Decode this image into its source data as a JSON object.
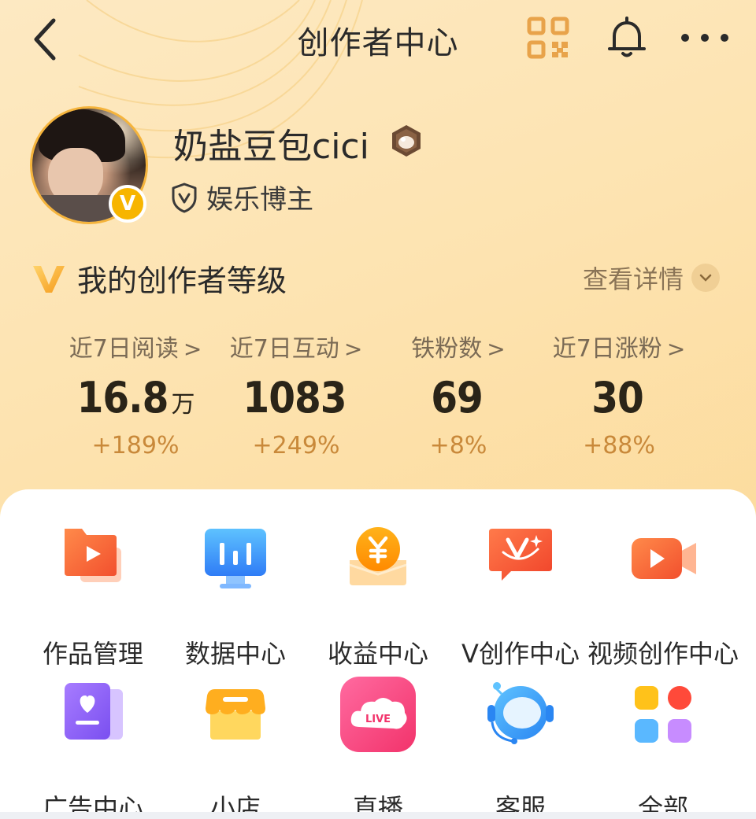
{
  "header": {
    "title": "创作者中心",
    "icons": [
      "back-chevron-icon",
      "qr-code-icon",
      "bell-icon",
      "more-dots-icon"
    ],
    "qr_color": "#e8a34a"
  },
  "profile": {
    "username": "奶盐豆包cici",
    "verified_badge": "V",
    "role": "娱乐博主"
  },
  "level": {
    "title": "我的创作者等级",
    "detail_link": "查看详情"
  },
  "stats": [
    {
      "label": "近7日阅读",
      "value": "16.8",
      "unit": "万",
      "change": "+189%"
    },
    {
      "label": "近7日互动",
      "value": "1083",
      "unit": "",
      "change": "+249%"
    },
    {
      "label": "铁粉数",
      "value": "69",
      "unit": "",
      "change": "+8%"
    },
    {
      "label": "近7日涨粉",
      "value": "30",
      "unit": "",
      "change": "+88%"
    }
  ],
  "stat_chevron": ">",
  "tools": [
    {
      "label": "作品管理",
      "icon": "works-folder-play-icon"
    },
    {
      "label": "数据中心",
      "icon": "data-chart-icon"
    },
    {
      "label": "收益中心",
      "icon": "yuan-coin-icon"
    },
    {
      "label": "V创作中心",
      "icon": "v-creation-icon"
    },
    {
      "label": "视频创作中心",
      "icon": "video-camera-icon"
    },
    {
      "label": "广告中心",
      "icon": "ad-heart-book-icon"
    },
    {
      "label": "小店",
      "icon": "shop-awning-icon"
    },
    {
      "label": "直播",
      "icon": "live-icon"
    },
    {
      "label": "客服",
      "icon": "customer-service-astronaut-icon"
    },
    {
      "label": "全部",
      "icon": "all-apps-grid-icon"
    }
  ],
  "live_badge_text": "LIVE",
  "colors": {
    "accent_orange": "#f26b3a",
    "gold": "#f5b43c",
    "change_text": "#c9893a",
    "background_gradient_start": "#fde9c2",
    "background_gradient_end": "#fcd68f"
  }
}
